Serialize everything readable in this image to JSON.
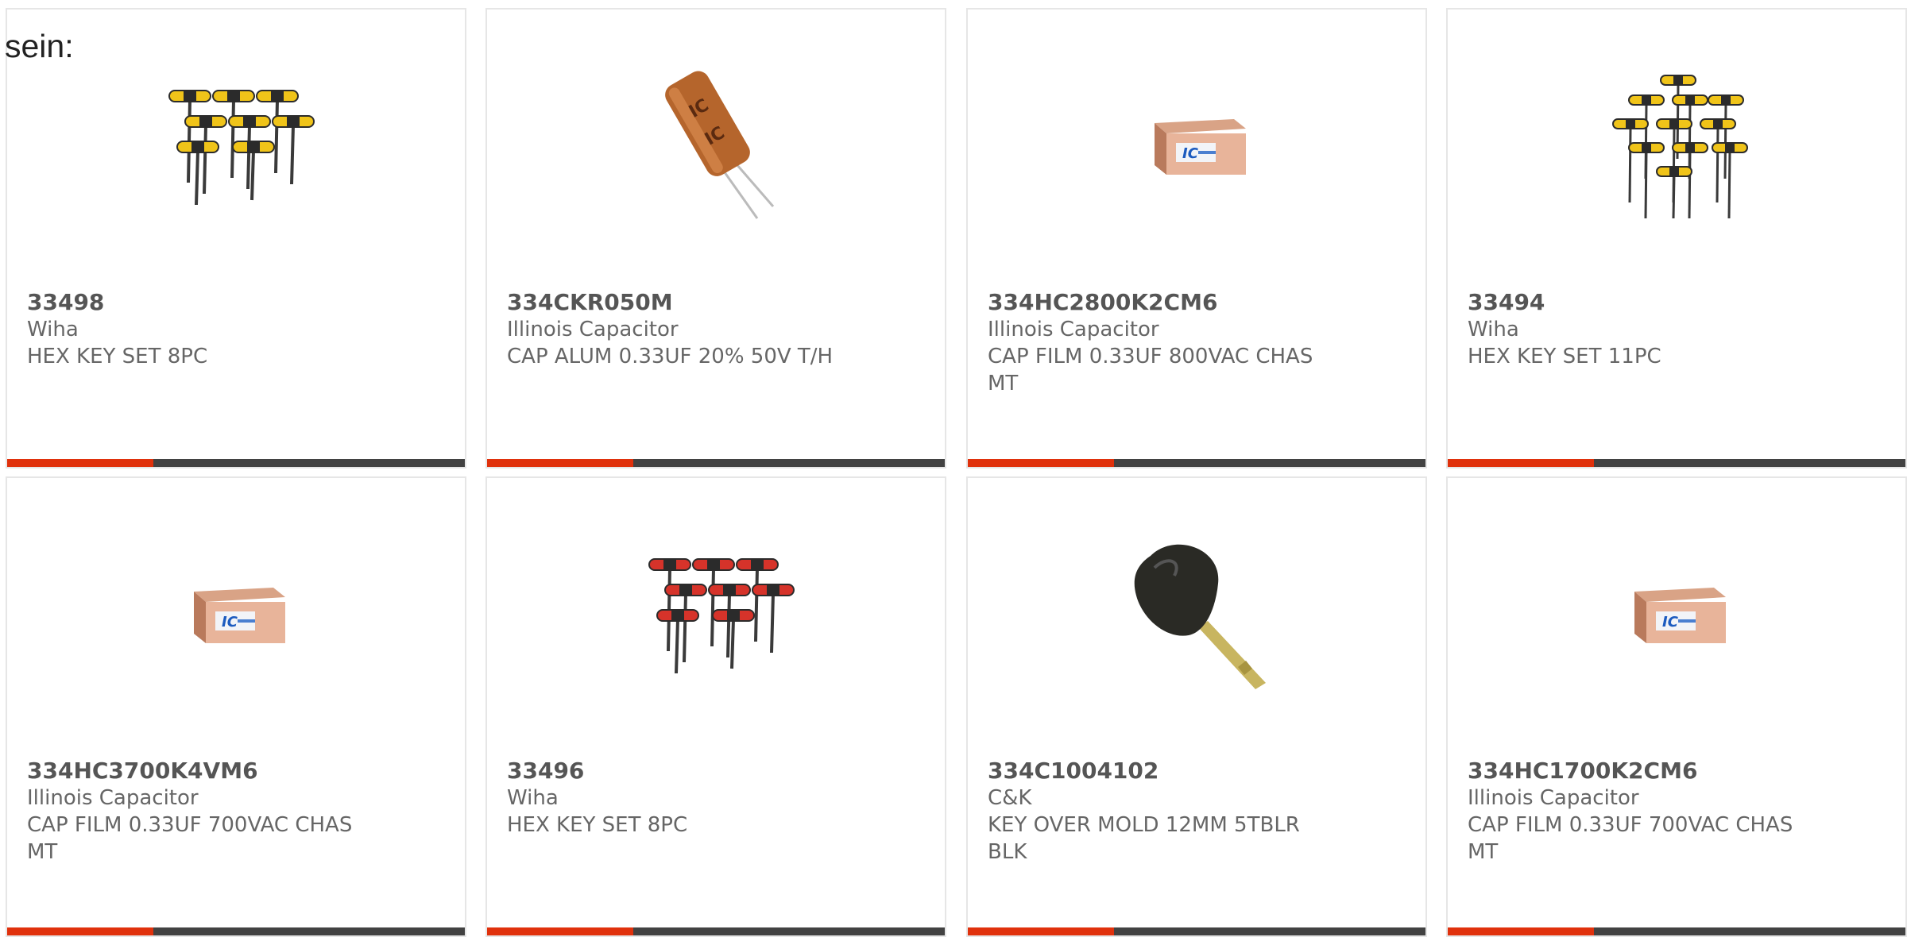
{
  "heading": "sein:",
  "colors": {
    "accent": "#e0310c",
    "bar": "#424242",
    "border": "#e6e6e6",
    "text": "#666666"
  },
  "products": [
    {
      "part_number": "33498",
      "manufacturer": "Wiha",
      "description": "HEX KEY SET 8PC",
      "image": "hex-key-set-yellow-icon",
      "progress": 0.32
    },
    {
      "part_number": "334CKR050M",
      "manufacturer": "Illinois Capacitor",
      "description": "CAP ALUM 0.33UF 20% 50V T/H",
      "image": "electrolytic-capacitor-icon",
      "progress": 0.32
    },
    {
      "part_number": "334HC2800K2CM6",
      "manufacturer": "Illinois Capacitor",
      "description": "CAP FILM 0.33UF 800VAC CHAS MT",
      "image": "film-capacitor-block-icon",
      "progress": 0.32
    },
    {
      "part_number": "33494",
      "manufacturer": "Wiha",
      "description": "HEX KEY SET 11PC",
      "image": "hex-key-set-yellow-icon",
      "progress": 0.32
    },
    {
      "part_number": "334HC3700K4VM6",
      "manufacturer": "Illinois Capacitor",
      "description": "CAP FILM 0.33UF 700VAC CHAS MT",
      "image": "film-capacitor-block-icon",
      "progress": 0.32
    },
    {
      "part_number": "33496",
      "manufacturer": "Wiha",
      "description": "HEX KEY SET 8PC",
      "image": "hex-key-set-red-icon",
      "progress": 0.32
    },
    {
      "part_number": "334C1004102",
      "manufacturer": "C&K",
      "description": "KEY OVER MOLD 12MM 5TBLR BLK",
      "image": "key-icon",
      "progress": 0.32
    },
    {
      "part_number": "334HC1700K2CM6",
      "manufacturer": "Illinois Capacitor",
      "description": "CAP FILM 0.33UF 700VAC CHAS MT",
      "image": "film-capacitor-block-icon",
      "progress": 0.32
    }
  ]
}
